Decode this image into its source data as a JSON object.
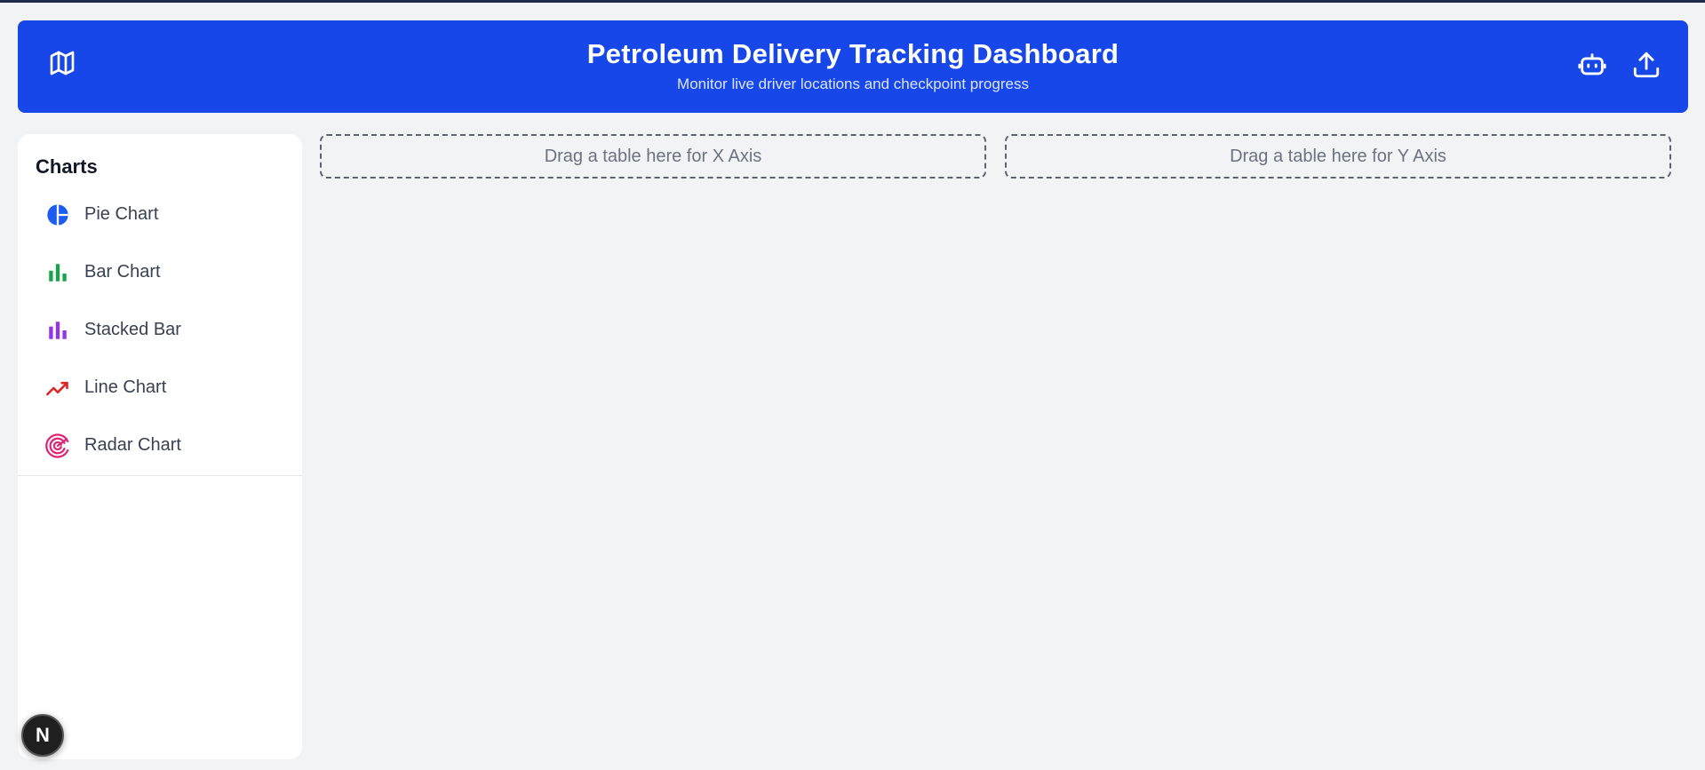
{
  "header": {
    "title": "Petroleum Delivery Tracking Dashboard",
    "subtitle": "Monitor live driver locations and checkpoint progress",
    "left_icon": "map-icon",
    "right_icons": [
      "bot-icon",
      "upload-icon"
    ],
    "background_color": "#1747e8"
  },
  "sidebar": {
    "heading": "Charts",
    "items": [
      {
        "label": "Pie Chart",
        "icon": "pie-chart-icon",
        "color": "#1d5cf0"
      },
      {
        "label": "Bar Chart",
        "icon": "bar-chart-icon",
        "color": "#16a34a"
      },
      {
        "label": "Stacked Bar",
        "icon": "stacked-bar-icon",
        "color": "#9333ea"
      },
      {
        "label": "Line Chart",
        "icon": "line-chart-icon",
        "color": "#dc2626"
      },
      {
        "label": "Radar Chart",
        "icon": "radar-chart-icon",
        "color": "#db2777"
      }
    ]
  },
  "dropzones": {
    "x_axis": "Drag a table here for X Axis",
    "y_axis": "Drag a table here for Y Axis"
  },
  "badge": {
    "letter": "N"
  }
}
